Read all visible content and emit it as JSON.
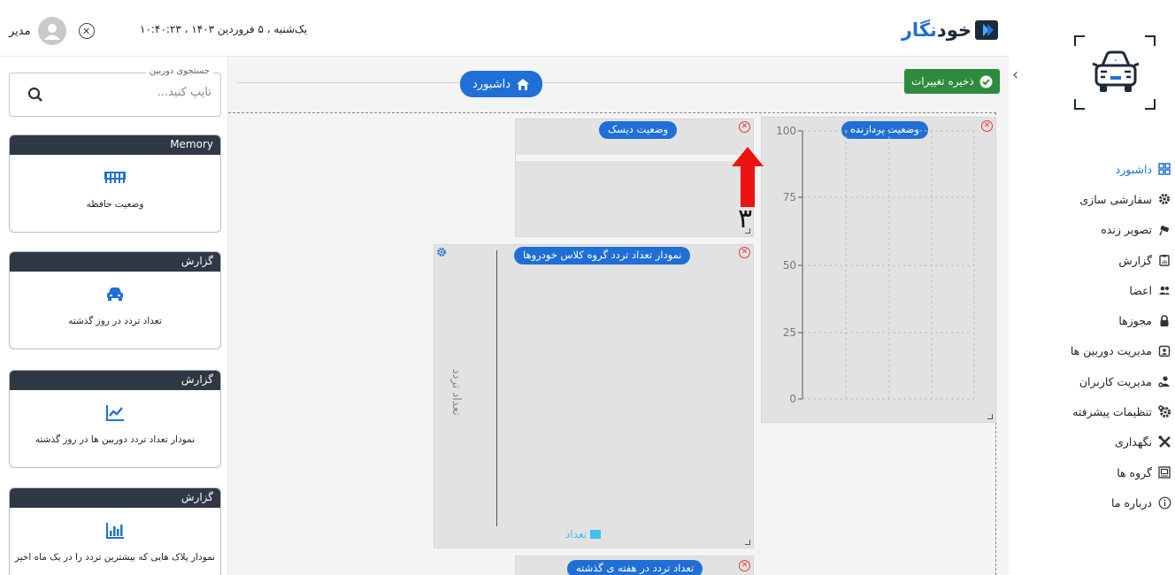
{
  "header": {
    "brand_part1": "خود",
    "brand_part2": "نگار",
    "datetime": "یک‌شنبه ، ۵ فروردین ۱۴۰۳ ، ۱۰:۴۰:۲۳",
    "username": "مدیر"
  },
  "sidebar": {
    "items": [
      {
        "label": "داشبورد",
        "icon": "dashboard-grid-icon",
        "active": true
      },
      {
        "label": "سفارشی سازی",
        "icon": "gear-icon"
      },
      {
        "label": "تصویر زنده",
        "icon": "cctv-camera-icon"
      },
      {
        "label": "گزارش",
        "icon": "clipboard-icon"
      },
      {
        "label": "اعضا",
        "icon": "members-icon"
      },
      {
        "label": "مجوزها",
        "icon": "lock-icon"
      },
      {
        "label": "مدیریت دوربین ها",
        "icon": "camera-box-icon"
      },
      {
        "label": "مدیریت کاربران",
        "icon": "user-gear-icon"
      },
      {
        "label": "تنظیمات پیشرفته",
        "icon": "gears-icon"
      },
      {
        "label": "نگهداری",
        "icon": "tools-icon"
      },
      {
        "label": "گروه ها",
        "icon": "groups-icon"
      },
      {
        "label": "درباره ما",
        "icon": "info-icon"
      }
    ]
  },
  "library": {
    "search_legend": "جستجوی دوربین",
    "search_placeholder": "تایپ کنید...",
    "cards": [
      {
        "category": "Memory",
        "icon": "memory-icon",
        "description": "وضعیت حافظه"
      },
      {
        "category": "گزارش",
        "icon": "car-icon",
        "description": "تعداد تردد در روز گذشته"
      },
      {
        "category": "گزارش",
        "icon": "line-chart-icon",
        "description": "نمودار تعداد تردد دوربین ها در روز گذشته"
      },
      {
        "category": "گزارش",
        "icon": "bar-chart-icon",
        "description": "نمودار پلاک هایی که بیشترین تردد را در یک ماه اخیر"
      }
    ]
  },
  "canvas": {
    "dashboard_label": "داشبورد",
    "save_label": "ذخیره تغییرات",
    "widgets": {
      "cpu": {
        "title": "وضعیت پردازنده",
        "y_ticks": [
          "100",
          "75",
          "50",
          "25",
          "0"
        ]
      },
      "disk": {
        "title": "وضعیت دیسک"
      },
      "class_chart": {
        "title": "نمودار تعداد تردد گروه کلاس خودروها",
        "y_label": "تعداد تردد",
        "legend": "تعداد"
      },
      "weekly": {
        "title": "تعداد تردد در هفته ی گذشته"
      }
    },
    "annotation_number": "۳"
  },
  "colors": {
    "primary": "#1f6fd6",
    "dark": "#2f3845",
    "save_green": "#2e8b3d",
    "close_red": "#e53935",
    "annotation_red": "#ee1111"
  }
}
